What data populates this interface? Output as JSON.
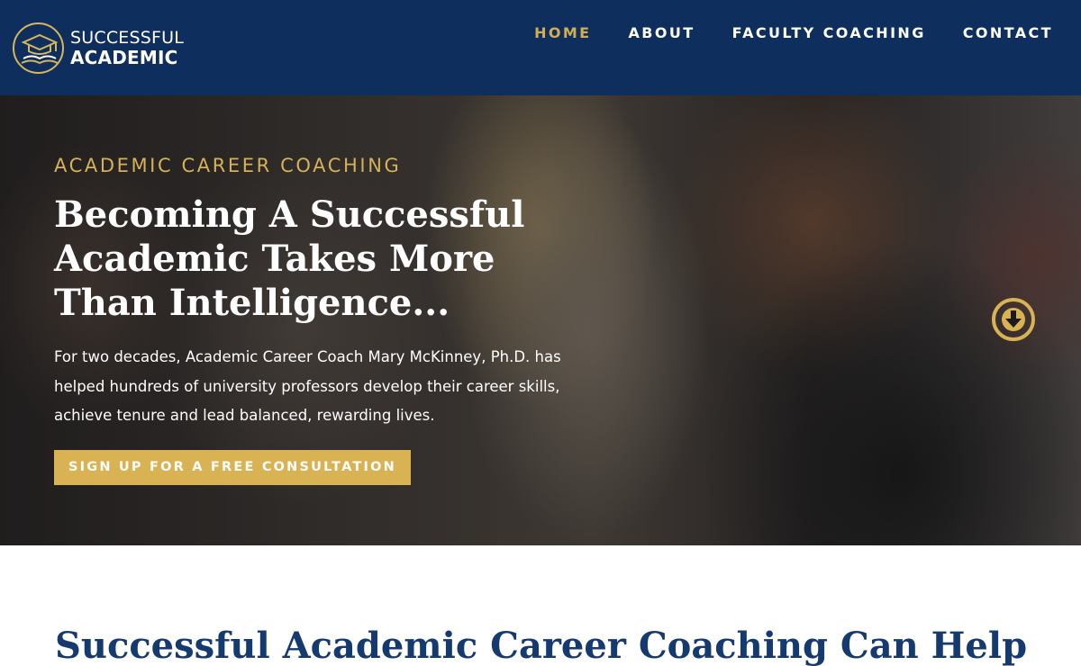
{
  "brand": {
    "name_line1": "SUCCESSFUL",
    "name_line2": "ACADEMIC",
    "logo_icon": "graduation-cap-book-icon"
  },
  "nav": {
    "items": [
      {
        "label": "HOME",
        "active": true
      },
      {
        "label": "ABOUT",
        "active": false
      },
      {
        "label": "FACULTY COACHING",
        "active": false
      },
      {
        "label": "CONTACT",
        "active": false
      }
    ]
  },
  "hero": {
    "eyebrow": "ACADEMIC CAREER COACHING",
    "title": "Becoming A Successful Academic Takes More Than Intelligence...",
    "text": "For two decades, Academic Career Coach Mary McKinney, Ph.D. has helped hundreds of university professors develop their career skills, achieve tenure and lead balanced, rewarding lives.",
    "cta_label": "SIGN UP FOR A FREE CONSULTATION",
    "scroll_icon": "arrow-down-circle-icon"
  },
  "section": {
    "title": "Successful Academic Career Coaching Can Help"
  },
  "colors": {
    "navy": "#0e2e5e",
    "gold": "#d9b253",
    "heading_blue": "#153a70"
  }
}
